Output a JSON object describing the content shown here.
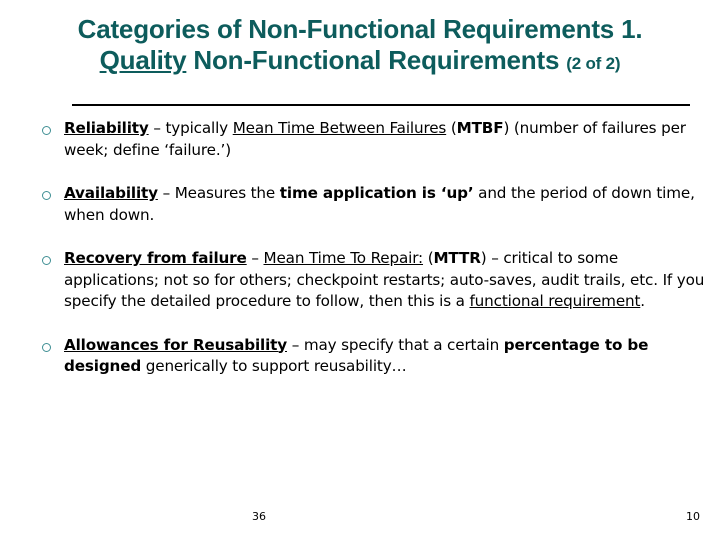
{
  "slide": {
    "title_line1": "Categories of Non-Functional Requirements  1.",
    "title_line2_underlined": "Quality",
    "title_line2_rest": "Non-Functional Requirements",
    "title_suffix": "(2 of 2)",
    "title_color": "#0d5c5c",
    "divider_color": "#000000",
    "bullet_marker_color": "#3f8f94",
    "bullets": [
      {
        "term": "Reliability",
        "dash": "–",
        "text_a": " typically ",
        "underlined_a": "Mean Time Between Failures",
        "text_b": " (",
        "bold_a": "MTBF",
        "text_c": ") (number of failures per week;  define ‘failure.’)"
      },
      {
        "term": "Availability",
        "dash": "–",
        "text_a": " Measures the ",
        "bold_a": "time application is ‘up’",
        "text_b": " and the period of down time, when down."
      },
      {
        "term": "Recovery from failure",
        "dash": "–",
        "text_a": " ",
        "underlined_a": "Mean Time To Repair:",
        "text_b": " (",
        "bold_a": "MTTR",
        "text_c": ") – critical to some applications;  not so for others;  checkpoint restarts;  auto-saves, audit trails, etc.  If you specify the detailed procedure to follow, then this is a ",
        "underlined_b": "functional requirement",
        "text_d": "."
      },
      {
        "term": "Allowances for Reusability",
        "dash": "–",
        "text_a": " may specify that a certain ",
        "bold_a": "percentage to be designed",
        "text_b": " generically to support reusability…"
      }
    ],
    "footer": {
      "slide_number": "36",
      "page_number": "10"
    }
  }
}
